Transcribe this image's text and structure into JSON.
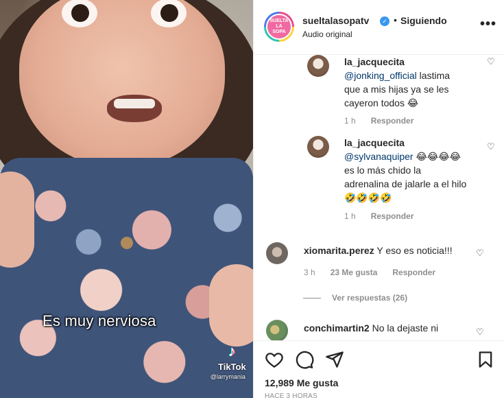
{
  "media": {
    "caption": "Es muy nerviosa",
    "watermark_brand": "TikTok",
    "watermark_handle": "@larrymania"
  },
  "header": {
    "avatar_text": [
      "SUELTA",
      "LA",
      "SOPA"
    ],
    "username": "sueltalasopatv",
    "separator": "•",
    "follow_status": "Siguiendo",
    "audio": "Audio original",
    "more": "•••"
  },
  "comments": [
    {
      "type": "reply",
      "username": "la_jacquecita",
      "mention": "@jonking_official",
      "text": " lastima que a mis hijas ya se les cayeron todos 😂",
      "time": "1 h",
      "reply_label": "Responder"
    },
    {
      "type": "reply",
      "username": "la_jacquecita",
      "mention": "@sylvanaquiper",
      "text": " 😂😂😂😂 es lo más chido la adrenalina de jalarle a el hilo 🤣🤣🤣🤣",
      "time": "1 h",
      "reply_label": "Responder"
    },
    {
      "type": "comment",
      "username": "xiomarita.perez",
      "text": " Y eso es noticia!!!",
      "time": "3 h",
      "likes": "23 Me gusta",
      "reply_label": "Responder"
    },
    {
      "type": "comment",
      "username": "conchimartin2",
      "text": " No la dejaste ni"
    }
  ],
  "view_replies": "Ver respuestas (26)",
  "likes": "12,989 Me gusta",
  "timeago": "HACE 3 HORAS",
  "colors": {
    "text": "#262626",
    "muted": "#8e8e8e",
    "mention": "#00376b",
    "verified": "#3897f0"
  }
}
